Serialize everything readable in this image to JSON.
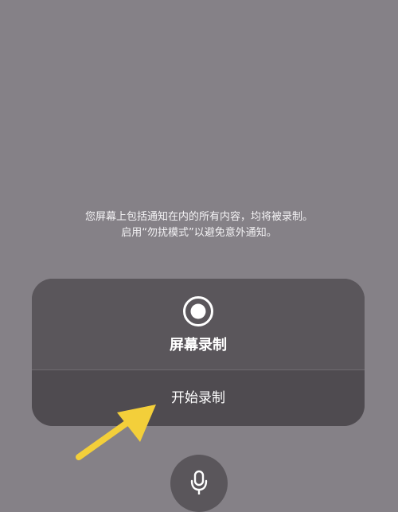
{
  "notice": {
    "line1": "您屏幕上包括通知在内的所有内容，均将被录制。",
    "line2": "启用“勿扰模式”以避免意外通知。"
  },
  "panel": {
    "title": "屏幕录制",
    "start_label": "开始录制"
  },
  "icons": {
    "record": "record-icon",
    "microphone": "microphone-icon",
    "annotation_arrow": "yellow-arrow"
  },
  "colors": {
    "background": "#858187",
    "panel": "#5a565b",
    "button": "#4f4b50",
    "arrow": "#f3cf3a",
    "text": "#ffffff"
  }
}
